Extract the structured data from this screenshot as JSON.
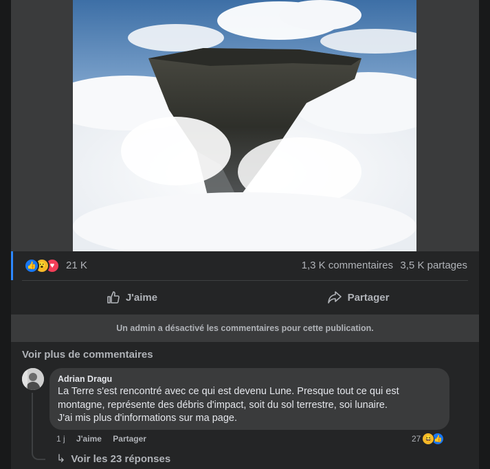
{
  "post": {
    "reactions": {
      "icons": [
        "like-icon",
        "wow-icon",
        "love-icon"
      ],
      "count": "21 K"
    },
    "comments_count": "1,3 K commentaires",
    "shares_count": "3,5 K partages",
    "actions": {
      "like_label": "J'aime",
      "share_label": "Partager"
    },
    "comments_disabled_notice": "Un admin a désactivé les commentaires pour cette publication."
  },
  "comments": {
    "more_label": "Voir plus de commentaires",
    "items": [
      {
        "author": "Adrian Dragu",
        "lines": [
          "La Terre s'est rencontré avec ce qui est devenu Lune. Presque tout ce qui est",
          "montagne, représente des débris d'impact, soit du sol terrestre, soi lunaire.",
          "J'ai mis plus d'informations sur ma page."
        ],
        "time": "1 j",
        "like_label": "J'aime",
        "share_label": "Partager",
        "reaction_count": "27",
        "reaction_icons": [
          "haha-icon",
          "like-icon"
        ],
        "replies_label": "Voir les 23 réponses"
      }
    ]
  },
  "colors": {
    "background": "#18191a",
    "card": "#242526",
    "bubble": "#3a3b3c",
    "accent": "#2d88ff",
    "text_primary": "#e4e6eb",
    "text_secondary": "#b0b3b8"
  }
}
